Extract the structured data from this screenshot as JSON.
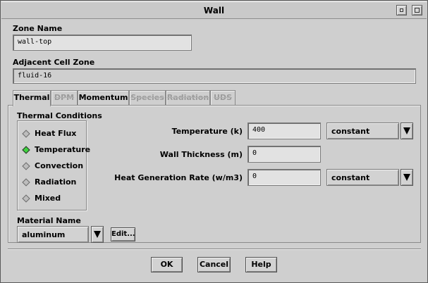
{
  "window": {
    "title": "Wall",
    "buttons": [
      "minimize-icon",
      "maximize-icon"
    ]
  },
  "zone": {
    "name_label": "Zone Name",
    "name_value": "wall-top",
    "adjacent_label": "Adjacent Cell Zone",
    "adjacent_value": "fluid-16"
  },
  "tabs": [
    {
      "label": "Thermal",
      "active": true,
      "enabled": true
    },
    {
      "label": "DPM",
      "active": false,
      "enabled": false
    },
    {
      "label": "Momentum",
      "active": false,
      "enabled": true
    },
    {
      "label": "Species",
      "active": false,
      "enabled": false
    },
    {
      "label": "Radiation",
      "active": false,
      "enabled": false
    },
    {
      "label": "UDS",
      "active": false,
      "enabled": false
    }
  ],
  "thermal": {
    "conditions_label": "Thermal Conditions",
    "options": [
      {
        "label": "Heat Flux",
        "selected": false
      },
      {
        "label": "Temperature",
        "selected": true
      },
      {
        "label": "Convection",
        "selected": false
      },
      {
        "label": "Radiation",
        "selected": false
      },
      {
        "label": "Mixed",
        "selected": false
      }
    ],
    "temperature_label": "Temperature (k)",
    "temperature_value": "400",
    "temperature_method": "constant",
    "wall_thickness_label": "Wall Thickness (m)",
    "wall_thickness_value": "0",
    "heat_gen_label": "Heat Generation Rate (w/m3)",
    "heat_gen_value": "0",
    "heat_gen_method": "constant",
    "material_label": "Material Name",
    "material_value": "aluminum",
    "edit_label": "Edit..."
  },
  "footer": {
    "ok": "OK",
    "cancel": "Cancel",
    "help": "Help"
  },
  "colors": {
    "background": "#cfcfcf",
    "selected_radio": "#3fd23f",
    "field_bg": "#e2e2e2"
  }
}
